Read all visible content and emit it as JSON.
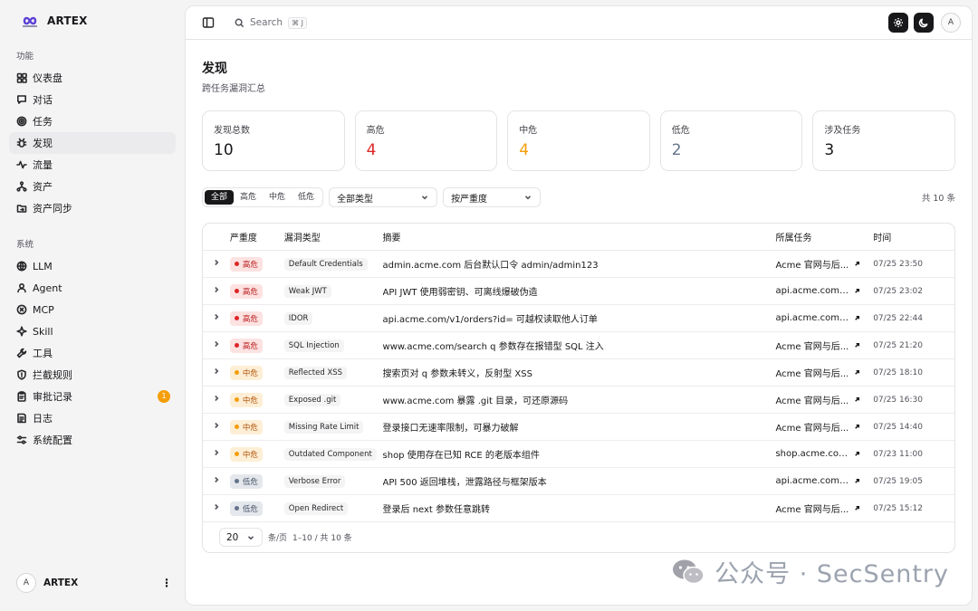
{
  "brand": {
    "name": "ARTEX"
  },
  "nav": {
    "section_function": "功能",
    "section_system": "系统",
    "items_function": [
      {
        "label": "仪表盘",
        "icon": "dashboard-icon"
      },
      {
        "label": "对话",
        "icon": "chat-icon"
      },
      {
        "label": "任务",
        "icon": "target-icon"
      },
      {
        "label": "发现",
        "icon": "bug-icon",
        "active": true
      },
      {
        "label": "流量",
        "icon": "activity-icon"
      },
      {
        "label": "资产",
        "icon": "network-icon"
      },
      {
        "label": "资产同步",
        "icon": "folder-sync-icon"
      }
    ],
    "items_system": [
      {
        "label": "LLM",
        "icon": "globe-icon"
      },
      {
        "label": "Agent",
        "icon": "agent-icon"
      },
      {
        "label": "MCP",
        "icon": "plug-icon"
      },
      {
        "label": "Skill",
        "icon": "sparkle-icon"
      },
      {
        "label": "工具",
        "icon": "wrench-icon"
      },
      {
        "label": "拦截规则",
        "icon": "shield-icon"
      },
      {
        "label": "审批记录",
        "icon": "clipboard-icon",
        "badge": "1"
      },
      {
        "label": "日志",
        "icon": "log-icon"
      },
      {
        "label": "系统配置",
        "icon": "sliders-icon"
      }
    ]
  },
  "user": {
    "avatar": "A",
    "name": "ARTEX"
  },
  "topbar": {
    "search_placeholder": "Search",
    "shortcut": "⌘ J",
    "avatar": "A"
  },
  "page": {
    "title": "发现",
    "subtitle": "跨任务漏洞汇总"
  },
  "stats": [
    {
      "label": "发现总数",
      "value": "10",
      "color": "#18181b"
    },
    {
      "label": "高危",
      "value": "4",
      "color": "#dc2626"
    },
    {
      "label": "中危",
      "value": "4",
      "color": "#f59e0b"
    },
    {
      "label": "低危",
      "value": "2",
      "color": "#64748b"
    },
    {
      "label": "涉及任务",
      "value": "3",
      "color": "#18181b"
    }
  ],
  "filters": {
    "segments": [
      "全部",
      "高危",
      "中危",
      "低危"
    ],
    "type_select": "全部类型",
    "sort_select": "按严重度",
    "total": "共 10 条"
  },
  "table": {
    "headers": {
      "severity": "严重度",
      "type": "漏洞类型",
      "summary": "摘要",
      "task": "所属任务",
      "time": "时间"
    },
    "rows": [
      {
        "severity": "高危",
        "level": "high",
        "type": "Default Credentials",
        "summary": "admin.acme.com 后台默认口令 admin/admin123",
        "task": "Acme 官网与后...",
        "time": "07/25 23:50"
      },
      {
        "severity": "高危",
        "level": "high",
        "type": "Weak JWT",
        "summary": "API JWT 使用弱密钥、可离线爆破伪造",
        "task": "api.acme.com ...",
        "time": "07/25 23:02"
      },
      {
        "severity": "高危",
        "level": "high",
        "type": "IDOR",
        "summary": "api.acme.com/v1/orders?id= 可越权读取他人订单",
        "task": "api.acme.com ...",
        "time": "07/25 22:44"
      },
      {
        "severity": "高危",
        "level": "high",
        "type": "SQL Injection",
        "summary": "www.acme.com/search q 参数存在报错型 SQL 注入",
        "task": "Acme 官网与后...",
        "time": "07/25 21:20"
      },
      {
        "severity": "中危",
        "level": "mid",
        "type": "Reflected XSS",
        "summary": "搜索页对 q 参数未转义，反射型 XSS",
        "task": "Acme 官网与后...",
        "time": "07/25 18:10"
      },
      {
        "severity": "中危",
        "level": "mid",
        "type": "Exposed .git",
        "summary": "www.acme.com 暴露 .git 目录，可还原源码",
        "task": "Acme 官网与后...",
        "time": "07/25 16:30"
      },
      {
        "severity": "中危",
        "level": "mid",
        "type": "Missing Rate Limit",
        "summary": "登录接口无速率限制，可暴力破解",
        "task": "Acme 官网与后...",
        "time": "07/25 14:40"
      },
      {
        "severity": "中危",
        "level": "mid",
        "type": "Outdated Component",
        "summary": "shop 使用存在已知 RCE 的老版本组件",
        "task": "shop.acme.com ...",
        "time": "07/23 11:00"
      },
      {
        "severity": "低危",
        "level": "low",
        "type": "Verbose Error",
        "summary": "API 500 返回堆栈，泄露路径与框架版本",
        "task": "api.acme.com ...",
        "time": "07/25 19:05"
      },
      {
        "severity": "低危",
        "level": "low",
        "type": "Open Redirect",
        "summary": "登录后 next 参数任意跳转",
        "task": "Acme 官网与后...",
        "time": "07/25 15:12"
      }
    ]
  },
  "pager": {
    "page_size": "20",
    "per_page_label": "条/页",
    "range": "1–10 / 共 10 条"
  },
  "watermark": {
    "text": "公众号 · SecSentry"
  }
}
